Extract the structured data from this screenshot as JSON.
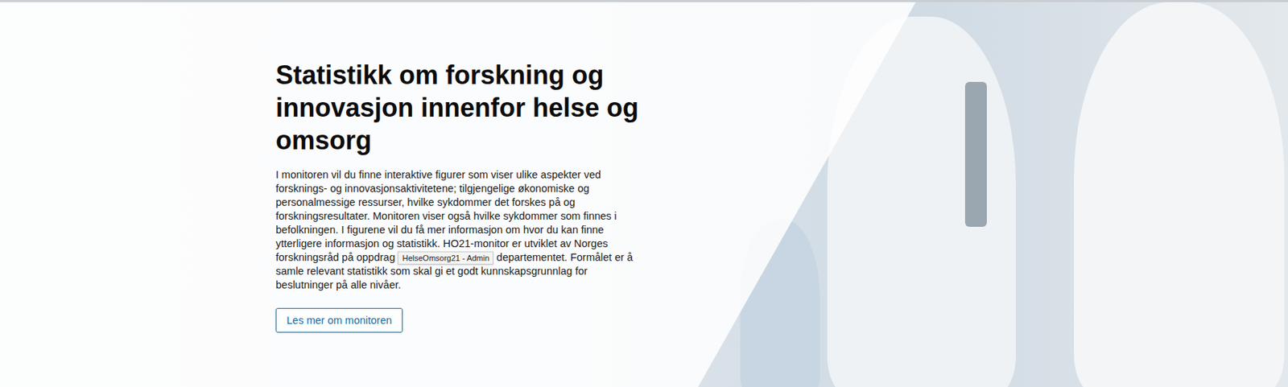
{
  "hero": {
    "title": "Statistikk om forskning og innovasjon innenfor helse og omsorg",
    "description_before_tooltip": "I monitoren vil du finne interaktive figurer som viser ulike aspekter ved forsknings- og innovasjonsaktivitetene; tilgjengelige økonomiske og personalmessige ressurser, hvilke sykdommer det forskes på og forskningsresultater. Monitoren viser også hvilke sykdommer som finnes i befolkningen. I figurene vil du få mer informasjon om hvor du kan finne ytterligere informasjon og statistikk. HO21-monitor er utviklet av Norges forskningsråd på oppdrag",
    "description_after_tooltip": "departementet. Formålet er å samle relevant statistikk som skal gi et godt kunnskapsgrunnlag for beslutninger på alle nivåer.",
    "button": "Les mer om monitoren"
  },
  "tooltip": {
    "text": "HelseOmsorg21 - Admin"
  }
}
